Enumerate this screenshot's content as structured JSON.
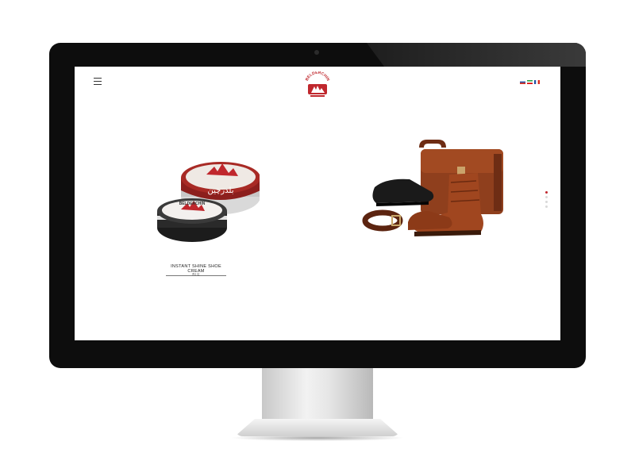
{
  "header": {
    "menu_icon": "hamburger-menu-icon",
    "logo_text": "BELDERCHIN",
    "languages": [
      {
        "code": "ru",
        "colors": [
          "#ffffff",
          "#1f4fa3",
          "#d52b1e"
        ]
      },
      {
        "code": "ir",
        "colors": [
          "#239f40",
          "#ffffff",
          "#da0000"
        ]
      },
      {
        "code": "fr",
        "colors": [
          "#1f4fa3",
          "#ffffff",
          "#d52b1e"
        ]
      }
    ]
  },
  "product": {
    "title": "INSTANT SHINE SHOE CREAM",
    "subtitle": "BLE",
    "tin_label_brand": "BELDERCHIN",
    "tin_label_persian": "بلدرچین"
  },
  "slider": {
    "dot_count": 4,
    "active_index": 0
  },
  "colors": {
    "brand_red": "#c0272d",
    "bezel": "#0d0d0d",
    "leather": "#8a3b1c"
  }
}
